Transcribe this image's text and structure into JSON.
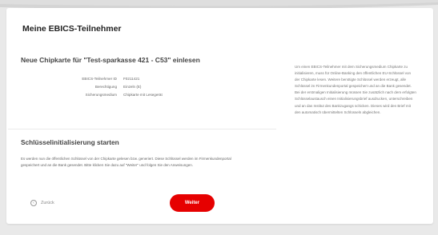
{
  "page": {
    "title": "Meine EBICS-Teilnehmer"
  },
  "chipcard": {
    "heading": "Neue Chipkarte für \"Test-sparkasse 421 - C53\" einlesen",
    "fields": [
      {
        "label": "EBICS-Teilnehmer ID",
        "value": "F0211421"
      },
      {
        "label": "Berechtigung",
        "value": "Einzeln (E)"
      },
      {
        "label": "Sicherungsmedium",
        "value": "Chipkarte mit Lesegerät"
      }
    ]
  },
  "key_init": {
    "heading": "Schlüsselinitialisierung starten",
    "description": "Es werden nun die öffentlichen Schlüssel von der Chipkarte gelesen bzw. generiert. Diese Schlüssel werden im Firmenkundenportal gespeichert und an die Bank gesendet. Bitte klicken Sie dazu auf \"Weiter\" und folgen Sie den Anweisungen."
  },
  "actions": {
    "back_label": "Zurück",
    "next_label": "Weiter"
  },
  "info": {
    "text": "Um einen EBICS-Teilnehmer mit dem Sicherungsmedium Chipkarte zu initialisieren, muss für Online-Banking den öffentlichen EU-Schlüssel von der Chipkarte lesen. Weitere benötigte Schlüssel werden erzeugt, alle Schlüssel im Firmenkundenportal gespeichert und an die Bank gesendet. Bei der erstmaligen Initialisierung müssen Sie zusätzlich nach dem erfolgten Schlüsselaustausch einen Initialisierungsbrief ausdrucken, unterschreiben und an das Institut des Bankzugangs schicken. Dieses wird den Brief mit den automatisch übermittelten Schlüsseln abgleichen."
  },
  "colors": {
    "accent": "#e60000",
    "background": "#e9e9e9",
    "card": "#ffffff"
  }
}
